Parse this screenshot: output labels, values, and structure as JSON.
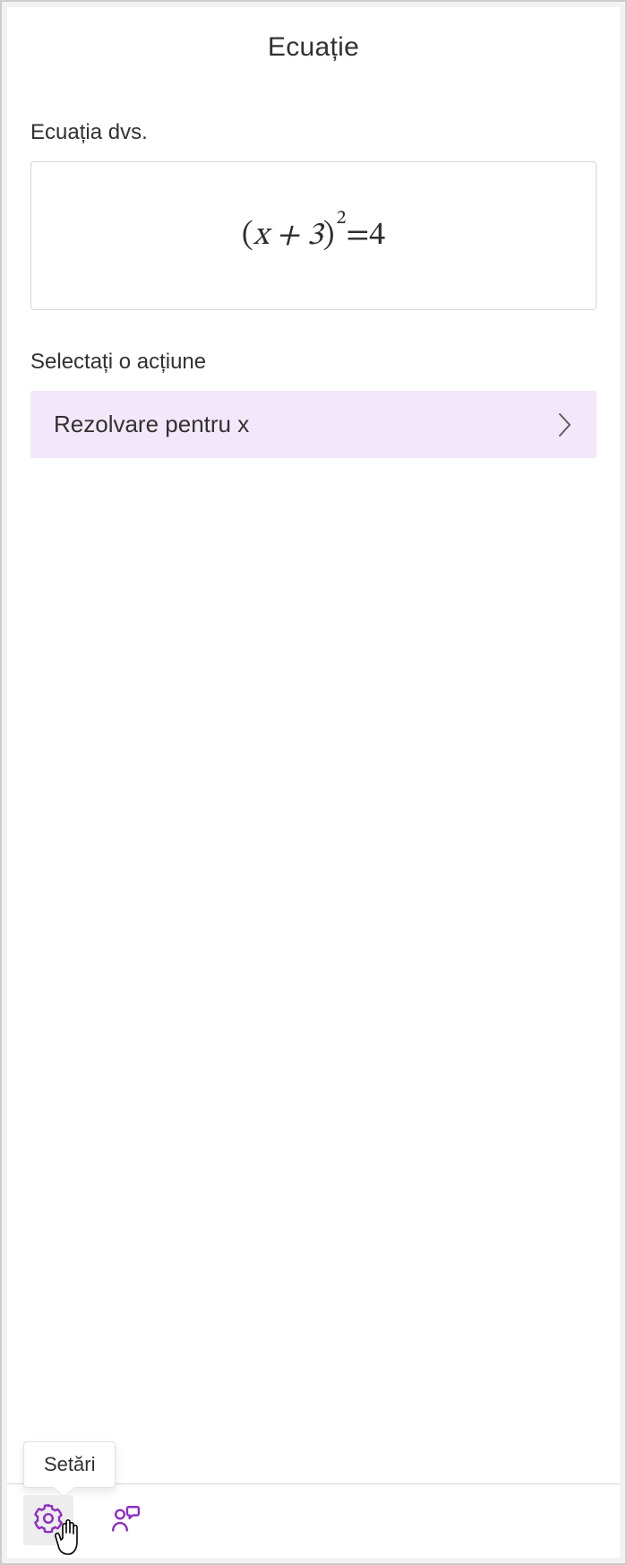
{
  "header": {
    "title": "Ecuație"
  },
  "equation": {
    "section_label": "Ecuația dvs.",
    "lhs_inner": "x + 3",
    "exponent": "2",
    "eq_sign": " = ",
    "rhs": "4"
  },
  "action": {
    "section_label": "Selectați o acțiune",
    "items": [
      {
        "label": "Rezolvare pentru x"
      }
    ]
  },
  "toolbar": {
    "settings_tooltip": "Setări"
  },
  "colors": {
    "accent": "#8e2ec4",
    "action_bg": "#f3e8fb"
  }
}
